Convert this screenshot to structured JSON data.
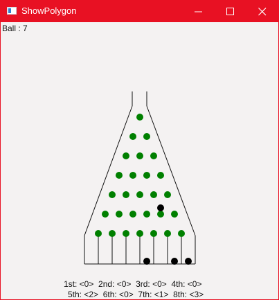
{
  "window": {
    "title": "ShowPolygon",
    "accent": "#e81123",
    "title_icon": "app-window-icon",
    "controls": [
      "minimize-icon",
      "maximize-icon",
      "close-icon"
    ]
  },
  "status": {
    "ball_label": "Ball : 7"
  },
  "board": {
    "peg_color": "#008000",
    "ball_color": "#000000",
    "peg_rows": 7,
    "slot_count": 8,
    "falling_ball": {
      "row": 5,
      "slot": 6
    },
    "landed_balls": [
      {
        "slot": 5
      },
      {
        "slot": 7
      },
      {
        "slot": 8
      }
    ]
  },
  "counts": {
    "line1": "1st: <0>  2nd: <0>  3rd: <0>  4th: <0>",
    "line2": "5th: <2>  6th: <0>  7th: <1>  8th: <3>"
  }
}
